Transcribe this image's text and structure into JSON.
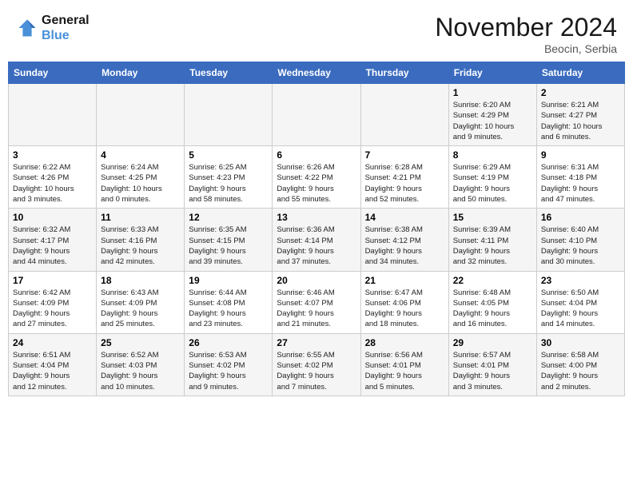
{
  "header": {
    "logo_line1": "General",
    "logo_line2": "Blue",
    "month": "November 2024",
    "location": "Beocin, Serbia"
  },
  "days_of_week": [
    "Sunday",
    "Monday",
    "Tuesday",
    "Wednesday",
    "Thursday",
    "Friday",
    "Saturday"
  ],
  "weeks": [
    [
      {
        "day": "",
        "info": ""
      },
      {
        "day": "",
        "info": ""
      },
      {
        "day": "",
        "info": ""
      },
      {
        "day": "",
        "info": ""
      },
      {
        "day": "",
        "info": ""
      },
      {
        "day": "1",
        "info": "Sunrise: 6:20 AM\nSunset: 4:29 PM\nDaylight: 10 hours\nand 9 minutes."
      },
      {
        "day": "2",
        "info": "Sunrise: 6:21 AM\nSunset: 4:27 PM\nDaylight: 10 hours\nand 6 minutes."
      }
    ],
    [
      {
        "day": "3",
        "info": "Sunrise: 6:22 AM\nSunset: 4:26 PM\nDaylight: 10 hours\nand 3 minutes."
      },
      {
        "day": "4",
        "info": "Sunrise: 6:24 AM\nSunset: 4:25 PM\nDaylight: 10 hours\nand 0 minutes."
      },
      {
        "day": "5",
        "info": "Sunrise: 6:25 AM\nSunset: 4:23 PM\nDaylight: 9 hours\nand 58 minutes."
      },
      {
        "day": "6",
        "info": "Sunrise: 6:26 AM\nSunset: 4:22 PM\nDaylight: 9 hours\nand 55 minutes."
      },
      {
        "day": "7",
        "info": "Sunrise: 6:28 AM\nSunset: 4:21 PM\nDaylight: 9 hours\nand 52 minutes."
      },
      {
        "day": "8",
        "info": "Sunrise: 6:29 AM\nSunset: 4:19 PM\nDaylight: 9 hours\nand 50 minutes."
      },
      {
        "day": "9",
        "info": "Sunrise: 6:31 AM\nSunset: 4:18 PM\nDaylight: 9 hours\nand 47 minutes."
      }
    ],
    [
      {
        "day": "10",
        "info": "Sunrise: 6:32 AM\nSunset: 4:17 PM\nDaylight: 9 hours\nand 44 minutes."
      },
      {
        "day": "11",
        "info": "Sunrise: 6:33 AM\nSunset: 4:16 PM\nDaylight: 9 hours\nand 42 minutes."
      },
      {
        "day": "12",
        "info": "Sunrise: 6:35 AM\nSunset: 4:15 PM\nDaylight: 9 hours\nand 39 minutes."
      },
      {
        "day": "13",
        "info": "Sunrise: 6:36 AM\nSunset: 4:14 PM\nDaylight: 9 hours\nand 37 minutes."
      },
      {
        "day": "14",
        "info": "Sunrise: 6:38 AM\nSunset: 4:12 PM\nDaylight: 9 hours\nand 34 minutes."
      },
      {
        "day": "15",
        "info": "Sunrise: 6:39 AM\nSunset: 4:11 PM\nDaylight: 9 hours\nand 32 minutes."
      },
      {
        "day": "16",
        "info": "Sunrise: 6:40 AM\nSunset: 4:10 PM\nDaylight: 9 hours\nand 30 minutes."
      }
    ],
    [
      {
        "day": "17",
        "info": "Sunrise: 6:42 AM\nSunset: 4:09 PM\nDaylight: 9 hours\nand 27 minutes."
      },
      {
        "day": "18",
        "info": "Sunrise: 6:43 AM\nSunset: 4:09 PM\nDaylight: 9 hours\nand 25 minutes."
      },
      {
        "day": "19",
        "info": "Sunrise: 6:44 AM\nSunset: 4:08 PM\nDaylight: 9 hours\nand 23 minutes."
      },
      {
        "day": "20",
        "info": "Sunrise: 6:46 AM\nSunset: 4:07 PM\nDaylight: 9 hours\nand 21 minutes."
      },
      {
        "day": "21",
        "info": "Sunrise: 6:47 AM\nSunset: 4:06 PM\nDaylight: 9 hours\nand 18 minutes."
      },
      {
        "day": "22",
        "info": "Sunrise: 6:48 AM\nSunset: 4:05 PM\nDaylight: 9 hours\nand 16 minutes."
      },
      {
        "day": "23",
        "info": "Sunrise: 6:50 AM\nSunset: 4:04 PM\nDaylight: 9 hours\nand 14 minutes."
      }
    ],
    [
      {
        "day": "24",
        "info": "Sunrise: 6:51 AM\nSunset: 4:04 PM\nDaylight: 9 hours\nand 12 minutes."
      },
      {
        "day": "25",
        "info": "Sunrise: 6:52 AM\nSunset: 4:03 PM\nDaylight: 9 hours\nand 10 minutes."
      },
      {
        "day": "26",
        "info": "Sunrise: 6:53 AM\nSunset: 4:02 PM\nDaylight: 9 hours\nand 9 minutes."
      },
      {
        "day": "27",
        "info": "Sunrise: 6:55 AM\nSunset: 4:02 PM\nDaylight: 9 hours\nand 7 minutes."
      },
      {
        "day": "28",
        "info": "Sunrise: 6:56 AM\nSunset: 4:01 PM\nDaylight: 9 hours\nand 5 minutes."
      },
      {
        "day": "29",
        "info": "Sunrise: 6:57 AM\nSunset: 4:01 PM\nDaylight: 9 hours\nand 3 minutes."
      },
      {
        "day": "30",
        "info": "Sunrise: 6:58 AM\nSunset: 4:00 PM\nDaylight: 9 hours\nand 2 minutes."
      }
    ]
  ]
}
